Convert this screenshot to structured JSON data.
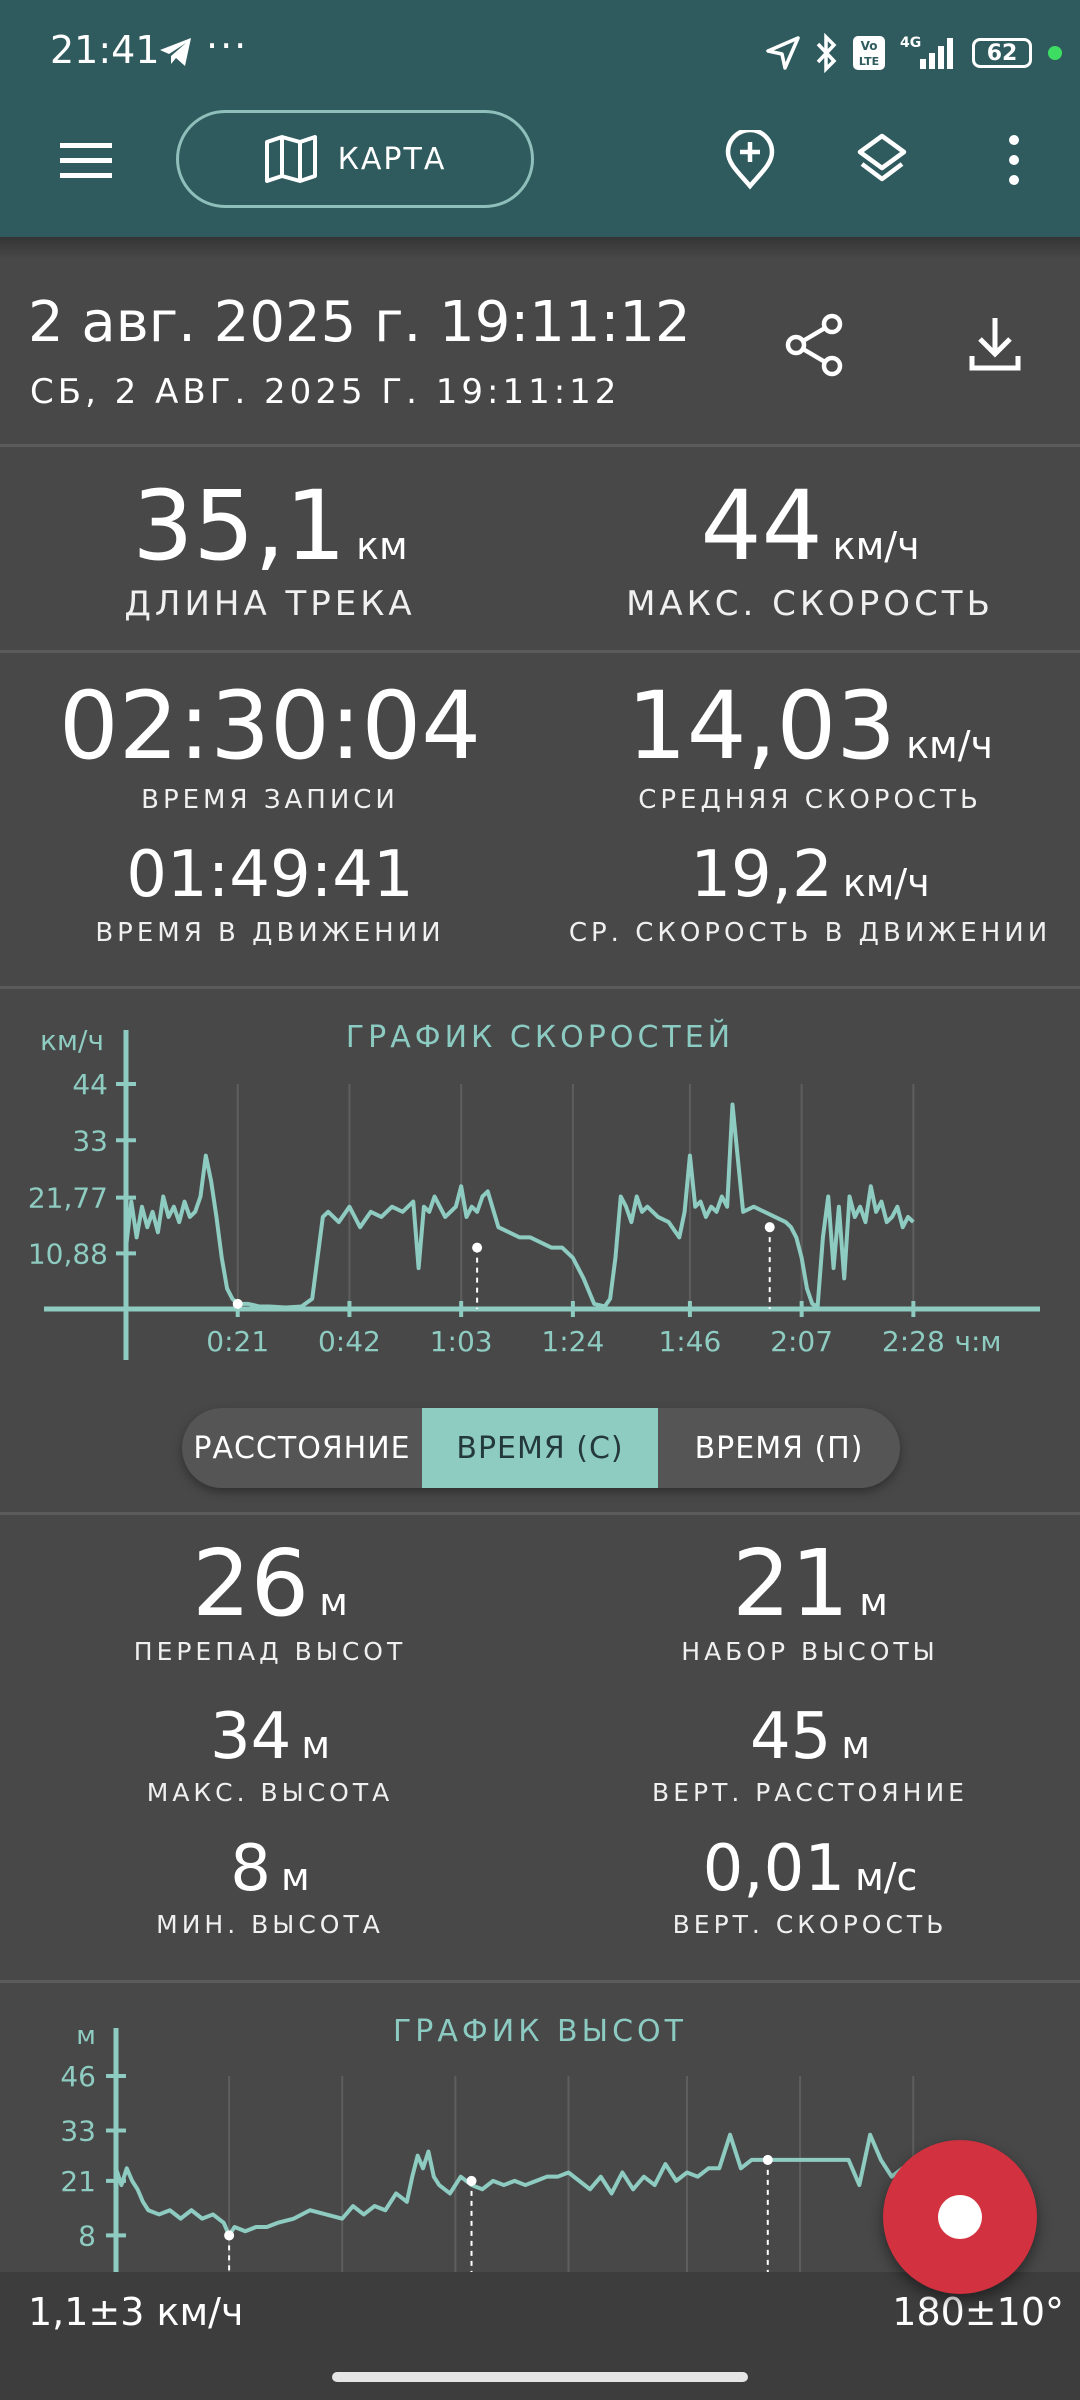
{
  "status_bar": {
    "time": "21:41",
    "dots": "···",
    "battery": "62",
    "network": "4G"
  },
  "appbar": {
    "map_label": "КАРТА"
  },
  "header": {
    "date_main": "2 авг. 2025 г. 19:11:12",
    "date_sub": "СБ, 2 АВГ. 2025 Г. 19:11:12"
  },
  "stats": {
    "track_length": {
      "value": "35,1",
      "unit": "км",
      "label": "ДЛИНА ТРЕКА"
    },
    "max_speed": {
      "value": "44",
      "unit": "км/ч",
      "label": "МАКС. СКОРОСТЬ"
    },
    "record_time": {
      "value": "02:30:04",
      "label": "ВРЕМЯ ЗАПИСИ"
    },
    "avg_speed": {
      "value": "14,03",
      "unit": "км/ч",
      "label": "СРЕДНЯЯ СКОРОСТЬ"
    },
    "moving_time": {
      "value": "01:49:41",
      "label": "ВРЕМЯ В ДВИЖЕНИИ"
    },
    "moving_avg_speed": {
      "value": "19,2",
      "unit": "км/ч",
      "label": "СР. СКОРОСТЬ В ДВИЖЕНИИ"
    }
  },
  "toggle": {
    "distance": "РАССТОЯНИЕ",
    "time_c": "ВРЕМЯ (С)",
    "time_p": "ВРЕМЯ (П)"
  },
  "elevation": {
    "drop": {
      "value": "26",
      "unit": "м",
      "label": "ПЕРЕПАД ВЫСОТ"
    },
    "gain": {
      "value": "21",
      "unit": "м",
      "label": "НАБОР ВЫСОТЫ"
    },
    "max": {
      "value": "34",
      "unit": "м",
      "label": "МАКС. ВЫСОТА"
    },
    "vert_distance": {
      "value": "45",
      "unit": "м",
      "label": "ВЕРТ. РАССТОЯНИЕ"
    },
    "min": {
      "value": "8",
      "unit": "м",
      "label": "МИН. ВЫСОТА"
    },
    "vert_speed": {
      "value": "0,01",
      "unit": "м/с",
      "label": "ВЕРТ. СКОРОСТЬ"
    }
  },
  "bottom": {
    "speed": "1,1±3 км/ч",
    "bearing": "180±10°"
  },
  "colors": {
    "accent": "#8ecbc1",
    "topbar": "#2f5b5e",
    "background": "#484848",
    "record": "#d2313f"
  },
  "chart_data": [
    {
      "type": "line",
      "title": "ГРАФИК СКОРОСТЕЙ",
      "ylabel": "км/ч",
      "xlabel": "ч:м",
      "x_ticks": [
        "0:21",
        "0:42",
        "1:03",
        "1:24",
        "1:46",
        "2:07",
        "2:28"
      ],
      "y_ticks": [
        "10,88",
        "21,77",
        "33",
        "44"
      ],
      "ylim": [
        0,
        44
      ],
      "xlim_min": [
        0,
        150
      ],
      "series": [
        {
          "x": [
            0,
            1,
            2,
            3,
            4,
            5,
            6,
            7,
            8,
            9,
            10,
            11,
            12,
            13,
            14,
            15,
            16,
            17,
            18,
            19,
            20,
            21,
            23,
            25,
            27,
            30,
            33,
            35,
            36,
            37,
            38,
            40,
            42,
            44,
            46,
            48,
            50,
            52,
            54,
            55,
            56,
            57,
            58,
            60,
            62,
            63,
            64,
            65,
            66,
            67,
            68,
            70,
            72,
            74,
            76,
            78,
            80,
            82,
            84,
            86,
            88,
            90,
            91,
            92,
            93,
            94,
            95,
            96,
            97,
            98,
            100,
            102,
            104,
            105,
            106,
            107,
            108,
            109,
            110,
            111,
            112,
            113,
            114,
            116,
            118,
            120,
            122,
            124,
            125,
            126,
            127,
            128,
            129,
            130,
            131,
            132,
            133,
            134,
            135,
            136,
            137,
            138,
            139,
            140,
            141,
            142,
            143,
            144,
            145,
            146,
            147,
            148
          ],
          "values": [
            12,
            21,
            14,
            20,
            16,
            19,
            15,
            22,
            18,
            20,
            17,
            21,
            18,
            19,
            22,
            30,
            25,
            18,
            10,
            4,
            2,
            1,
            1,
            0.5,
            0.5,
            0.3,
            0.5,
            2,
            10,
            18,
            19,
            17,
            20,
            16,
            19,
            18,
            20,
            19,
            21,
            8,
            20,
            19,
            22,
            18,
            20,
            24,
            18,
            20,
            19,
            22,
            23,
            16,
            15,
            14,
            14,
            13,
            12,
            12,
            10,
            6,
            1,
            0.5,
            2,
            10,
            22,
            20,
            17,
            22,
            19,
            20,
            18,
            17,
            14,
            19,
            30,
            20,
            21,
            18,
            20,
            19,
            22,
            20,
            40,
            19,
            20,
            19,
            18,
            17,
            16,
            14,
            10,
            4,
            1,
            0.5,
            14,
            22,
            8,
            20,
            6,
            22,
            18,
            20,
            17,
            24,
            19,
            21,
            17,
            18,
            20,
            16,
            18,
            17
          ]
        }
      ]
    },
    {
      "type": "line",
      "title": "ГРАФИК ВЫСОТ",
      "ylabel": "м",
      "y_ticks": [
        "8",
        "21",
        "33",
        "46"
      ],
      "ylim": [
        5,
        46
      ],
      "series": [
        {
          "x": [
            0,
            1,
            2,
            3,
            4,
            5,
            6,
            8,
            10,
            12,
            14,
            16,
            18,
            20,
            21,
            22,
            24,
            26,
            28,
            30,
            33,
            36,
            39,
            42,
            44,
            46,
            48,
            50,
            52,
            54,
            55,
            56,
            57,
            58,
            59,
            60,
            62,
            64,
            66,
            68,
            70,
            72,
            74,
            76,
            78,
            80,
            82,
            84,
            86,
            88,
            90,
            92,
            94,
            96,
            98,
            100,
            102,
            104,
            106,
            108,
            110,
            112,
            114,
            116,
            118,
            120,
            122,
            124,
            126,
            128,
            130,
            132,
            134,
            136,
            138,
            140,
            142,
            144,
            146,
            148
          ],
          "values": [
            24,
            20,
            24,
            21,
            19,
            16,
            14,
            13,
            14,
            12,
            14,
            12,
            13,
            11,
            8,
            10,
            9,
            10,
            10,
            11,
            12,
            14,
            13,
            12,
            15,
            13,
            15,
            14,
            18,
            16,
            22,
            27,
            24,
            28,
            22,
            20,
            18,
            22,
            20,
            19,
            21,
            20,
            21,
            20,
            21,
            22,
            22,
            23,
            21,
            19,
            22,
            18,
            23,
            19,
            22,
            20,
            25,
            21,
            23,
            22,
            24,
            24,
            32,
            24,
            26,
            26,
            26,
            26,
            26,
            26,
            26,
            26,
            26,
            26,
            20,
            32,
            26,
            22,
            24,
            21
          ]
        }
      ]
    }
  ]
}
